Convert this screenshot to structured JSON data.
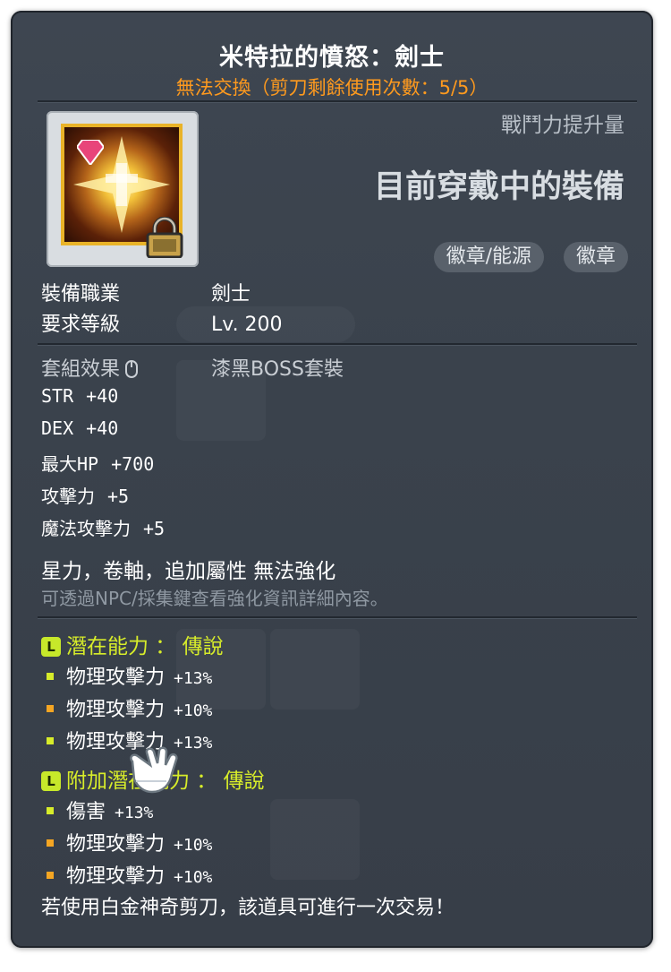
{
  "header": {
    "title": "米特拉的憤怒：劍士",
    "subtitle": "無法交換（剪刀剩餘使用次數：5/5）"
  },
  "item": {
    "icon": "mitra-rage-emblem-icon",
    "lock_icon": "padlock-icon",
    "combat_power_label": "戰鬥力提升量",
    "equipped_label": "目前穿戴中的裝備",
    "tags": [
      "徽章/能源",
      "徽章"
    ]
  },
  "requirements": {
    "job_label": "裝備職業",
    "job_value": "劍士",
    "level_label": "要求等級",
    "level_value": "Lv. 200"
  },
  "set": {
    "label": "套組效果",
    "value": "漆黑BOSS套裝"
  },
  "stats": [
    {
      "name": "STR",
      "value": "+40"
    },
    {
      "name": "DEX",
      "value": "+40"
    },
    {
      "name": "最大HP",
      "value": "+700"
    },
    {
      "name": "攻擊力",
      "value": "+5"
    },
    {
      "name": "魔法攻擊力",
      "value": "+5"
    }
  ],
  "enhance": {
    "line1": "星力，卷軸，追加屬性 無法強化",
    "line2": "可透過NPC/採集鍵查看強化資訊詳細內容。"
  },
  "potential": {
    "header": "潛在能力 ： 傳說",
    "badge": "L",
    "lines": [
      {
        "name": "物理攻擊力",
        "value": "+13%",
        "color": "#d7ec2a"
      },
      {
        "name": "物理攻擊力",
        "value": "+10%",
        "color": "#f5a623"
      },
      {
        "name": "物理攻擊力",
        "value": "+13%",
        "color": "#d7ec2a"
      }
    ]
  },
  "additional_potential": {
    "header": "附加潛在能力 ： 傳說",
    "badge": "L",
    "lines": [
      {
        "name": "傷害",
        "value": "+13%",
        "color": "#d7ec2a"
      },
      {
        "name": "物理攻擊力",
        "value": "+10%",
        "color": "#f5a623"
      },
      {
        "name": "物理攻擊力",
        "value": "+10%",
        "color": "#f5a623"
      }
    ]
  },
  "footer": "若使用白金神奇剪刀，該道具可進行一次交易！",
  "cursor_icon": "glove-cursor-icon",
  "colors": {
    "panel": "#3a424c",
    "subtitle": "#ff9a1e",
    "legendary": "#d7ec2a",
    "unique_line": "#f5a623"
  }
}
